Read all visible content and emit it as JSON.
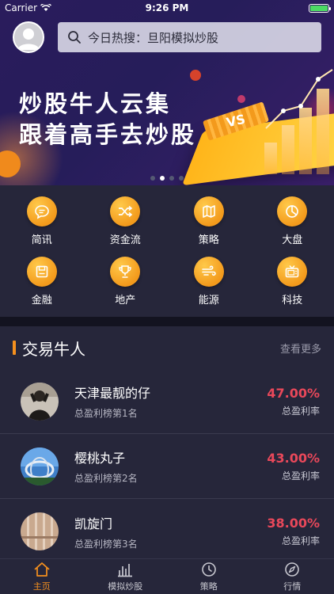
{
  "status_bar": {
    "carrier": "Carrier",
    "time": "9:26 PM"
  },
  "header": {
    "search_text": "今日热搜：旦阳模拟炒股"
  },
  "banner": {
    "slogan_line1": "炒股牛人云集",
    "slogan_line2": "跟着高手去炒股",
    "badge": "VS",
    "page_count": 4,
    "active_page": 2
  },
  "categories": [
    {
      "label": "简讯",
      "icon": "chat-bubble-icon"
    },
    {
      "label": "资金流",
      "icon": "shuffle-icon"
    },
    {
      "label": "策略",
      "icon": "map-icon"
    },
    {
      "label": "大盘",
      "icon": "pie-chart-icon"
    },
    {
      "label": "金融",
      "icon": "floppy-icon"
    },
    {
      "label": "地产",
      "icon": "trophy-icon"
    },
    {
      "label": "能源",
      "icon": "wind-icon"
    },
    {
      "label": "科技",
      "icon": "tv-icon"
    }
  ],
  "traders_section": {
    "title": "交易牛人",
    "more": "查看更多",
    "rows": [
      {
        "name": "天津最靓的仔",
        "rank": "总盈利榜第1名",
        "rate": "47.00%",
        "rate_label": "总盈利率"
      },
      {
        "name": "樱桃丸子",
        "rank": "总盈利榜第2名",
        "rate": "43.00%",
        "rate_label": "总盈利率"
      },
      {
        "name": "凯旋门",
        "rank": "总盈利榜第3名",
        "rate": "38.00%",
        "rate_label": "总盈利率"
      }
    ]
  },
  "tabbar": [
    {
      "label": "主页",
      "icon": "home-icon",
      "active": true
    },
    {
      "label": "模拟炒股",
      "icon": "bar-chart-icon",
      "active": false
    },
    {
      "label": "策略",
      "icon": "clock-icon",
      "active": false
    },
    {
      "label": "行情",
      "icon": "compass-icon",
      "active": false
    }
  ],
  "colors": {
    "accent": "#f5901e",
    "gain": "#e9485a",
    "background": "#26263a"
  }
}
